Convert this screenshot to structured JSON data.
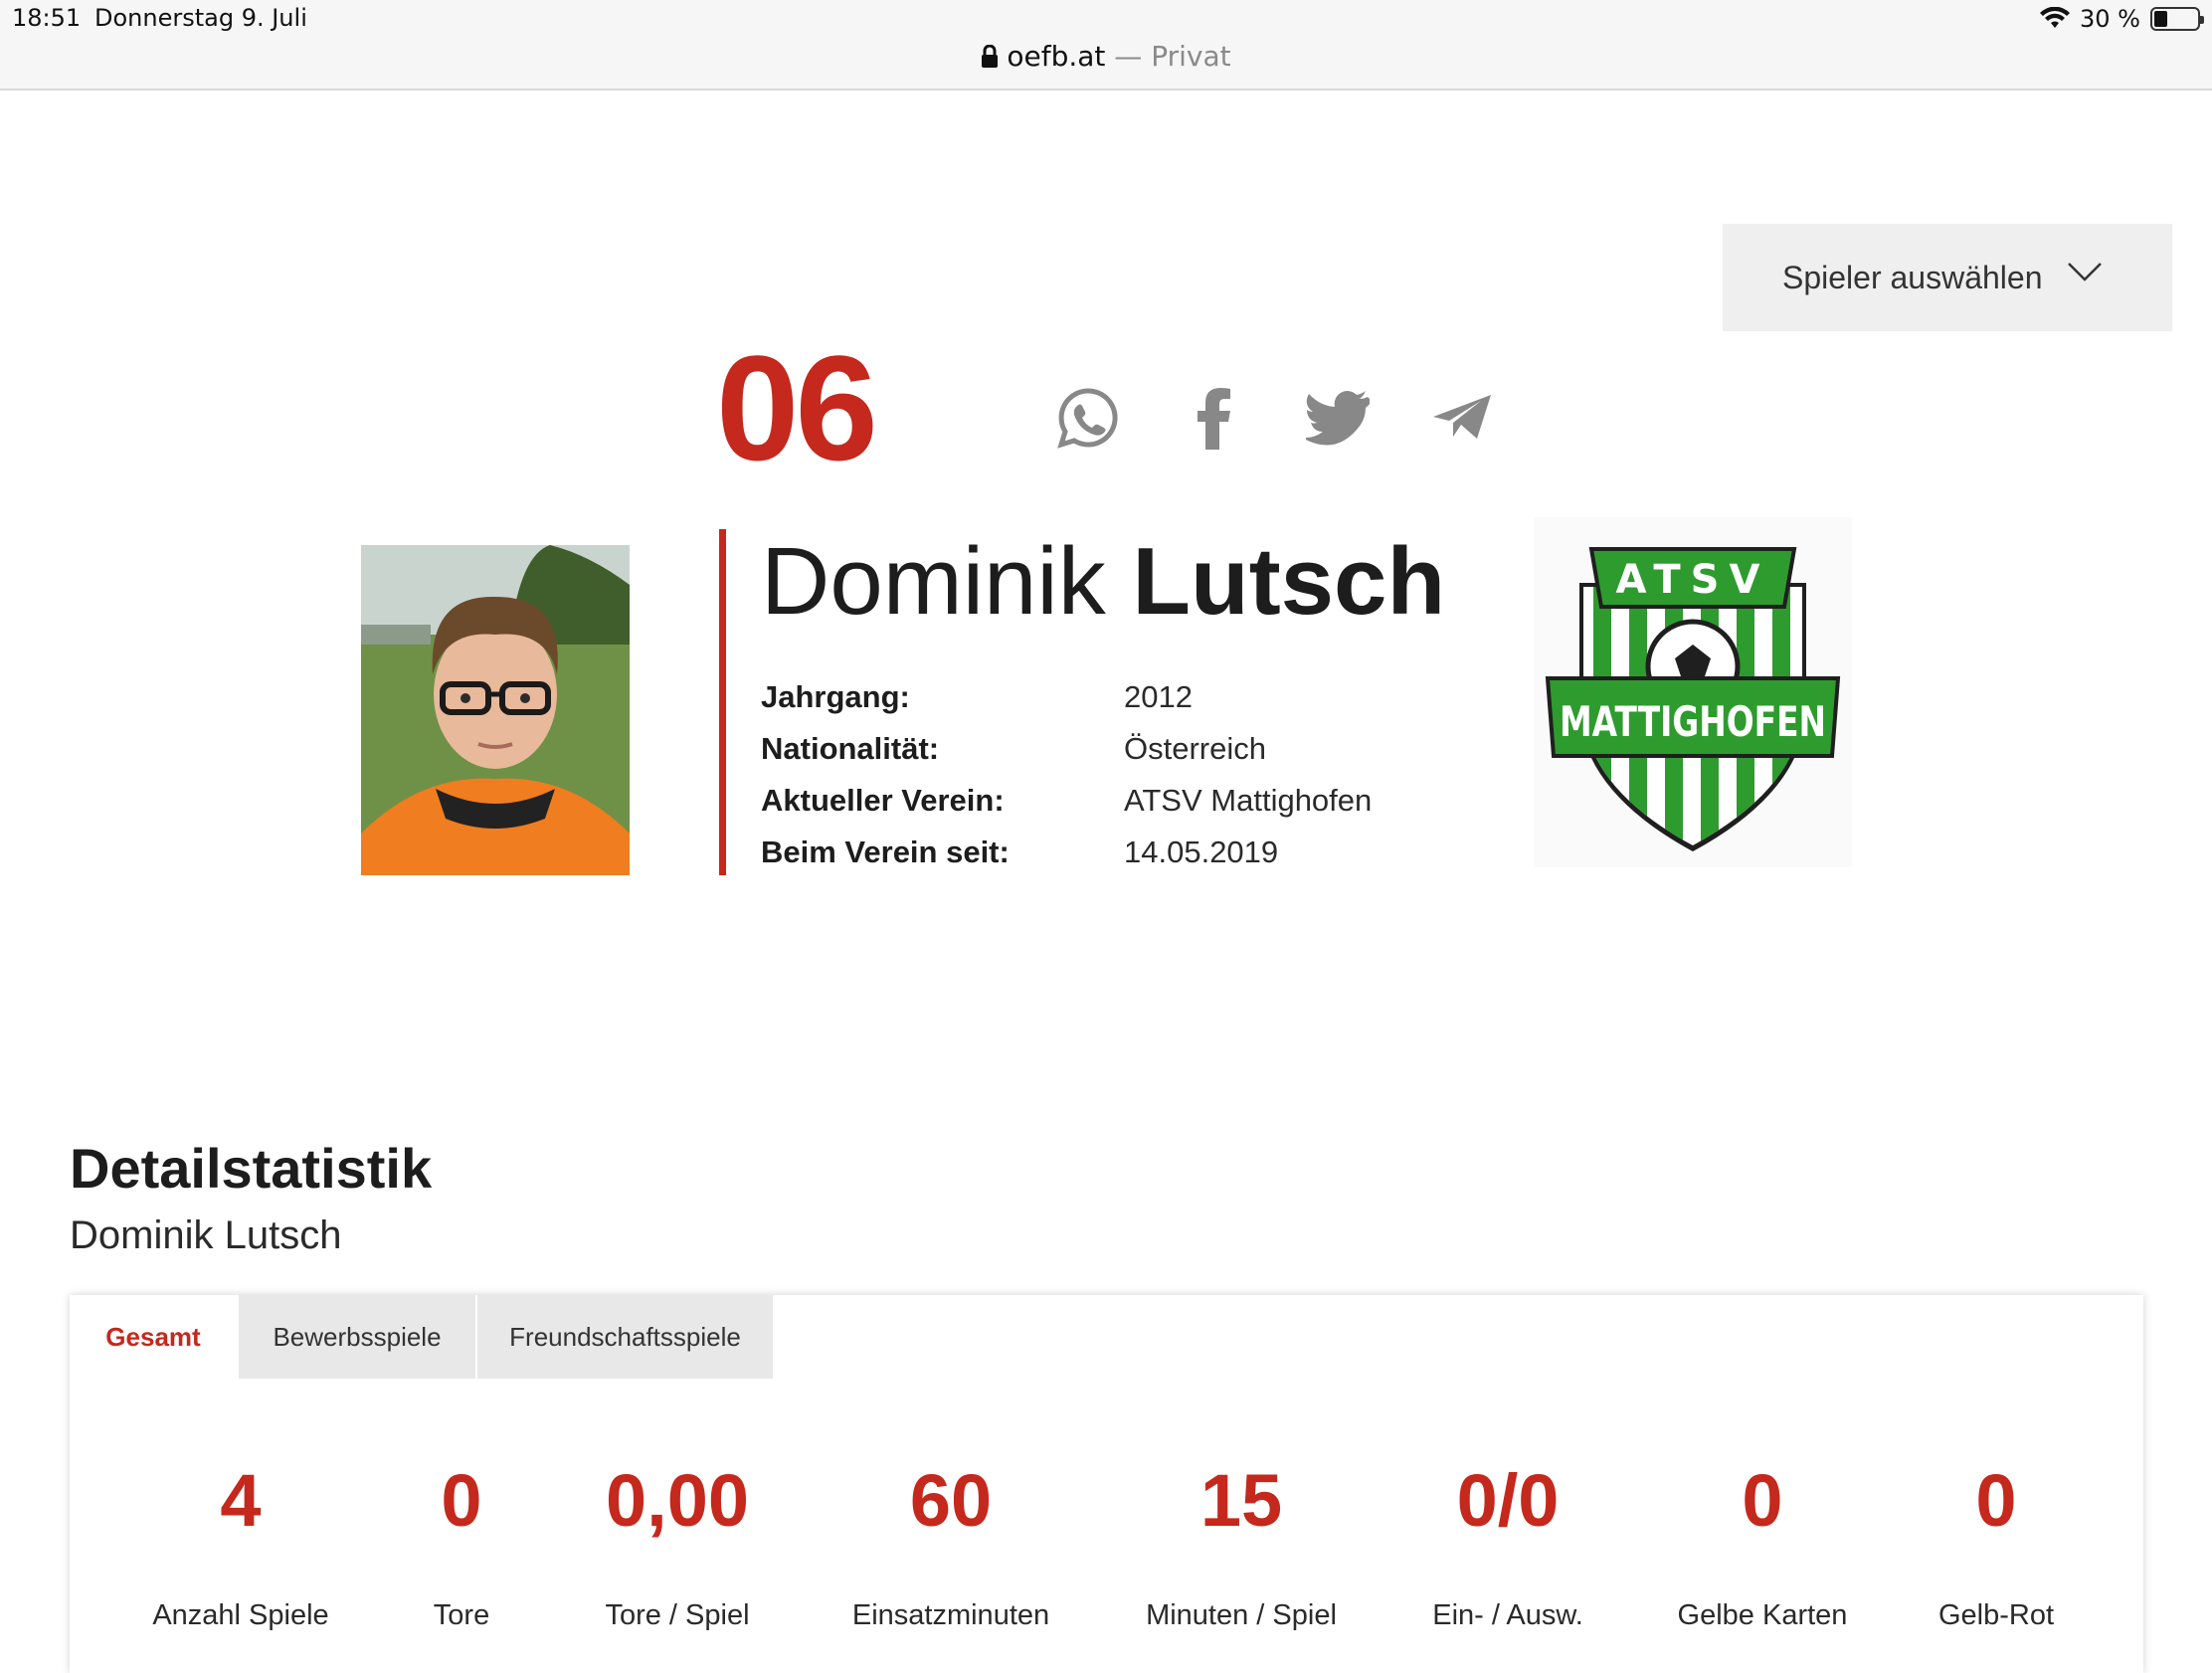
{
  "status_bar": {
    "time": "18:51",
    "date": "Donnerstag 9. Juli",
    "battery": "30 %",
    "battery_level": 0.3
  },
  "browser": {
    "domain": "oefb.at",
    "separator": " — ",
    "mode": "Privat"
  },
  "player_select": {
    "label": "Spieler auswählen"
  },
  "player": {
    "number": "06",
    "first_name": "Dominik",
    "last_name": "Lutsch",
    "facts": [
      {
        "label": "Jahrgang:",
        "value": "2012"
      },
      {
        "label": "Nationalität:",
        "value": "Österreich"
      },
      {
        "label": "Aktueller Verein:",
        "value": "ATSV Mattighofen"
      },
      {
        "label": "Beim Verein seit:",
        "value": "14.05.2019"
      }
    ]
  },
  "club_logo": {
    "top_text": "ATSV",
    "main_text": "MATTIGHOFEN",
    "color": "#2e9b2e"
  },
  "share_icons": [
    "whatsapp-icon",
    "facebook-icon",
    "twitter-icon",
    "telegram-icon"
  ],
  "detail": {
    "title": "Detailstatistik",
    "subtitle": "Dominik Lutsch",
    "tabs": [
      {
        "label": "Gesamt",
        "active": true
      },
      {
        "label": "Bewerbsspiele",
        "active": false
      },
      {
        "label": "Freundschaftsspiele",
        "active": false
      }
    ],
    "stats": [
      {
        "value": "4",
        "label": "Anzahl Spiele"
      },
      {
        "value": "0",
        "label": "Tore"
      },
      {
        "value": "0,00",
        "label": "Tore / Spiel"
      },
      {
        "value": "60",
        "label": "Einsatzminuten"
      },
      {
        "value": "15",
        "label": "Minuten / Spiel"
      },
      {
        "value": "0/0",
        "label": "Ein- / Ausw."
      },
      {
        "value": "0",
        "label": "Gelbe Karten"
      },
      {
        "value": "0",
        "label": "Gelb-Rot"
      }
    ]
  },
  "colors": {
    "accent": "#c5281c",
    "icon": "#888888"
  }
}
